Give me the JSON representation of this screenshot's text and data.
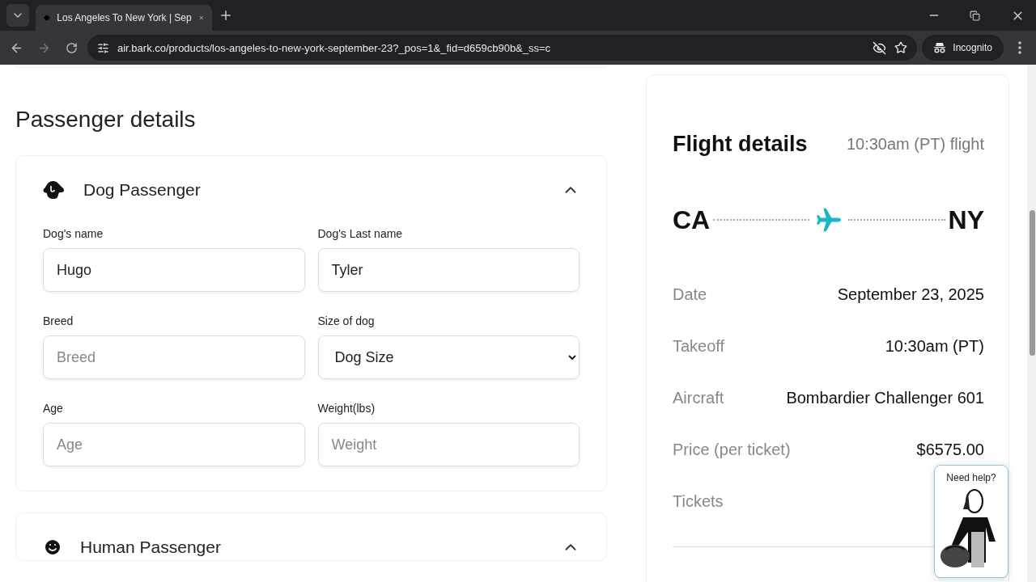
{
  "browser": {
    "tab_title": "Los Angeles To New York | Sep",
    "url": "air.bark.co/products/los-angeles-to-new-york-september-23?_pos=1&_fid=d659cb90b&_ss=c",
    "profile": "Incognito"
  },
  "heading": "Passenger details",
  "dog_passenger": {
    "title": "Dog Passenger",
    "expanded": true,
    "fields": [
      {
        "label": "Dog's name",
        "kind": "input",
        "value": "Hugo"
      },
      {
        "label": "Dog's Last name",
        "kind": "input",
        "value": "Tyler"
      },
      {
        "label": "Breed",
        "kind": "input",
        "placeholder": "Breed"
      },
      {
        "label": "Size of dog",
        "kind": "select",
        "value": "Dog Size"
      },
      {
        "label": "Age",
        "kind": "input",
        "placeholder": "Age"
      },
      {
        "label": "Weight(lbs)",
        "kind": "input",
        "placeholder": "Weight"
      }
    ]
  },
  "human_passenger": {
    "title": "Human Passenger",
    "expanded": true
  },
  "flight_details": {
    "title": "Flight details",
    "subtitle": "10:30am (PT) flight",
    "from": "CA",
    "to": "NY",
    "rows": [
      {
        "label": "Date",
        "value": "September 23, 2025"
      },
      {
        "label": "Takeoff",
        "value": "10:30am (PT)"
      },
      {
        "label": "Aircraft",
        "value": "Bombardier Challenger 601"
      },
      {
        "label": "Price (per ticket)",
        "value": "$6575.00"
      },
      {
        "label": "Tickets"
      }
    ]
  },
  "help_widget": {
    "label": "Need help?"
  }
}
